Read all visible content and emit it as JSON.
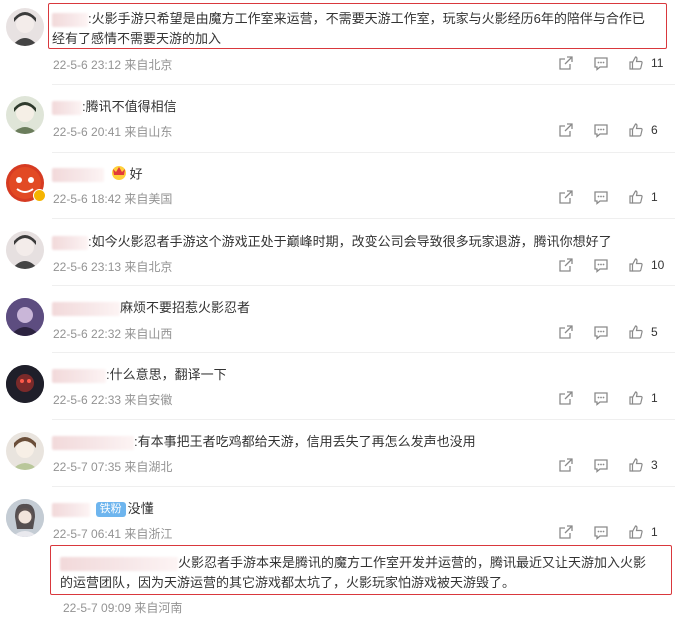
{
  "comments": [
    {
      "text": ":火影手游只希望是由魔方工作室来运营，不需要天游工作室，玩家与火影经历6年的陪伴与合作已",
      "text2": "经有了感情不需要天游的加入",
      "time": "22-5-6 23:12",
      "location": "来自北京",
      "likes": "11",
      "avatar_color": "#e8e2e2"
    },
    {
      "text": ":腾讯不值得相信",
      "time": "22-5-6 20:41",
      "location": "来自山东",
      "likes": "6",
      "avatar_color": "#dfe5d8"
    },
    {
      "text": "好",
      "time": "22-5-6 18:42",
      "location": "来自美国",
      "likes": "1",
      "avatar_color": "#d63b22"
    },
    {
      "text": ":如今火影忍者手游这个游戏正处于巅峰时期，改变公司会导致很多玩家退游，腾讯你想好了",
      "time": "22-5-6 23:13",
      "location": "来自北京",
      "likes": "10",
      "avatar_color": "#e6e0e0"
    },
    {
      "text": "麻烦不要招惹火影忍者",
      "time": "22-5-6 22:32",
      "location": "来自山西",
      "likes": "5",
      "avatar_color": "#6b5b8f"
    },
    {
      "text": ":什么意思，翻译一下",
      "time": "22-5-6 22:33",
      "location": "来自安徽",
      "likes": "1",
      "avatar_color": "#2a2a35"
    },
    {
      "text": ":有本事把王者吃鸡都给天游，信用丢失了再怎么发声也没用",
      "time": "22-5-7 07:35",
      "location": "来自湖北",
      "likes": "3",
      "avatar_color": "#e9e4de"
    },
    {
      "text": "没懂",
      "badge": "铁粉",
      "time": "22-5-7 06:41",
      "location": "来自浙江",
      "likes": "1",
      "avatar_color": "#c9cfd6"
    }
  ],
  "reply": {
    "text1": "火影忍者手游本来是腾讯的魔方工作室开发并运营的，腾讯最近又让天游加入火影",
    "text2": "的运营团队，因为天游运营的其它游戏都太坑了，火影玩家怕游戏被天游毁了。",
    "time": "22-5-7 09:09",
    "location": "来自河南"
  },
  "icons": {
    "share": "share-icon",
    "comment": "comment-icon",
    "like": "like-icon"
  },
  "colors": {
    "highlight": "#d9383d",
    "meta": "#939393",
    "fan_badge": "#6eb5ee"
  }
}
